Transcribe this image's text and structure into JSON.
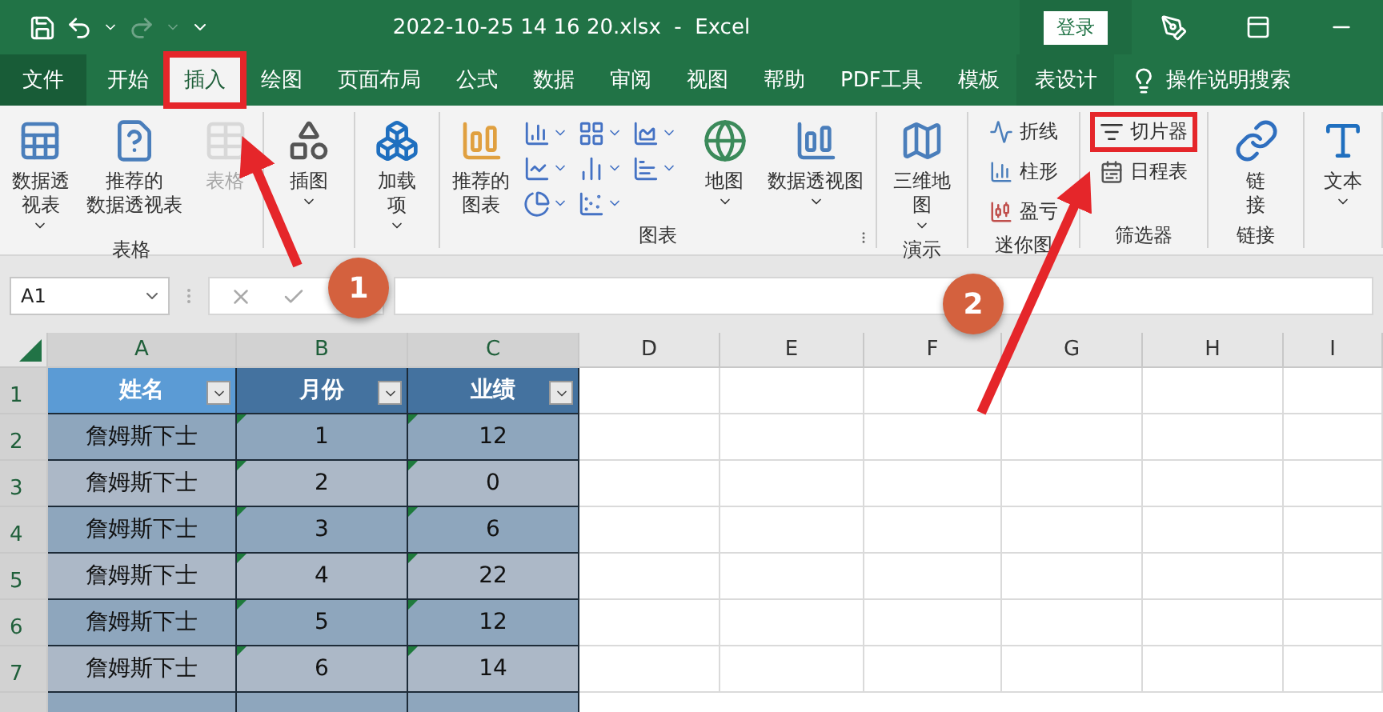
{
  "title_bar": {
    "title": "2022-10-25 14 16 20.xlsx  -  Excel",
    "login": "登录"
  },
  "tabs": [
    {
      "label": "文件",
      "kind": "file",
      "selected": false,
      "highlighted": false
    },
    {
      "label": "开始",
      "kind": "normal",
      "selected": false,
      "highlighted": false
    },
    {
      "label": "插入",
      "kind": "normal",
      "selected": true,
      "highlighted": true
    },
    {
      "label": "绘图",
      "kind": "normal",
      "selected": false,
      "highlighted": false
    },
    {
      "label": "页面布局",
      "kind": "normal",
      "selected": false,
      "highlighted": false
    },
    {
      "label": "公式",
      "kind": "normal",
      "selected": false,
      "highlighted": false
    },
    {
      "label": "数据",
      "kind": "normal",
      "selected": false,
      "highlighted": false
    },
    {
      "label": "审阅",
      "kind": "normal",
      "selected": false,
      "highlighted": false
    },
    {
      "label": "视图",
      "kind": "normal",
      "selected": false,
      "highlighted": false
    },
    {
      "label": "帮助",
      "kind": "normal",
      "selected": false,
      "highlighted": false
    },
    {
      "label": "PDF工具",
      "kind": "normal",
      "selected": false,
      "highlighted": false
    },
    {
      "label": "模板",
      "kind": "normal",
      "selected": false,
      "highlighted": false
    },
    {
      "label": "表设计",
      "kind": "context",
      "selected": false,
      "highlighted": false
    }
  ],
  "tell_me": "操作说明搜索",
  "ribbon_groups": [
    {
      "label": "表格",
      "items": [
        {
          "kind": "large",
          "lines": [
            "数据透",
            "视表"
          ],
          "dropdown": true,
          "disabled": false,
          "highlighted": false
        },
        {
          "kind": "large",
          "lines": [
            "推荐的",
            "数据透视表"
          ],
          "dropdown": false,
          "disabled": false,
          "highlighted": false
        },
        {
          "kind": "large",
          "lines": [
            "表格"
          ],
          "dropdown": false,
          "disabled": true,
          "highlighted": false
        }
      ]
    },
    {
      "items": [
        {
          "kind": "large",
          "lines": [
            "插图"
          ],
          "dropdown": true,
          "disabled": false,
          "highlighted": false
        }
      ]
    },
    {
      "items": [
        {
          "kind": "large",
          "lines": [
            "加载",
            "项"
          ],
          "dropdown": true,
          "disabled": false,
          "highlighted": false
        }
      ]
    },
    {
      "label": "图表",
      "launcher": true,
      "items": [
        {
          "kind": "large",
          "lines": [
            "推荐的",
            "图表"
          ],
          "dropdown": false,
          "disabled": false,
          "highlighted": false
        },
        {
          "kind": "icons",
          "dropdown": true,
          "disabled": false,
          "highlighted": false
        },
        {
          "kind": "large",
          "lines": [
            "地图"
          ],
          "dropdown": true,
          "disabled": false,
          "highlighted": false
        },
        {
          "kind": "large",
          "lines": [
            "数据透视图"
          ],
          "dropdown": true,
          "disabled": false,
          "highlighted": false
        }
      ]
    },
    {
      "label": "演示",
      "items": [
        {
          "kind": "large",
          "lines": [
            "三维地",
            "图"
          ],
          "dropdown": true,
          "disabled": false,
          "highlighted": false
        }
      ]
    },
    {
      "label": "迷你图",
      "items": [
        {
          "kind": "small",
          "lines": [
            "折线"
          ],
          "dropdown": false,
          "disabled": false,
          "highlighted": false
        },
        {
          "kind": "small",
          "lines": [
            "柱形"
          ],
          "dropdown": false,
          "disabled": false,
          "highlighted": false
        },
        {
          "kind": "small",
          "lines": [
            "盈亏"
          ],
          "dropdown": false,
          "disabled": false,
          "highlighted": false
        }
      ]
    },
    {
      "label": "筛选器",
      "items": [
        {
          "kind": "small",
          "lines": [
            "切片器"
          ],
          "dropdown": false,
          "disabled": false,
          "highlighted": true
        },
        {
          "kind": "small",
          "lines": [
            "日程表"
          ],
          "dropdown": false,
          "disabled": false,
          "highlighted": false
        }
      ]
    },
    {
      "label": "链接",
      "items": [
        {
          "kind": "large",
          "lines": [
            "链",
            "接"
          ],
          "dropdown": false,
          "disabled": false,
          "highlighted": false
        }
      ]
    },
    {
      "items": [
        {
          "kind": "large",
          "lines": [
            "文本"
          ],
          "dropdown": true,
          "disabled": false,
          "highlighted": false
        }
      ]
    }
  ],
  "formula_bar": {
    "name_box": "A1"
  },
  "sheet": {
    "columns": [
      "A",
      "B",
      "C",
      "D",
      "E",
      "F",
      "G",
      "H",
      "I"
    ],
    "row_numbers": [
      "1",
      "2",
      "3",
      "4",
      "5",
      "6",
      "7"
    ],
    "header": [
      {
        "text": "姓名",
        "selected": true
      },
      {
        "text": "月份",
        "selected": false
      },
      {
        "text": "业绩",
        "selected": false
      }
    ],
    "rows": [
      [
        "詹姆斯下士",
        "1",
        "12"
      ],
      [
        "詹姆斯下士",
        "2",
        "0"
      ],
      [
        "詹姆斯下士",
        "3",
        "6"
      ],
      [
        "詹姆斯下士",
        "4",
        "22"
      ],
      [
        "詹姆斯下士",
        "5",
        "12"
      ],
      [
        "詹姆斯下士",
        "6",
        "14"
      ]
    ]
  },
  "annotations": [
    {
      "label": "1"
    },
    {
      "label": "2"
    }
  ]
}
